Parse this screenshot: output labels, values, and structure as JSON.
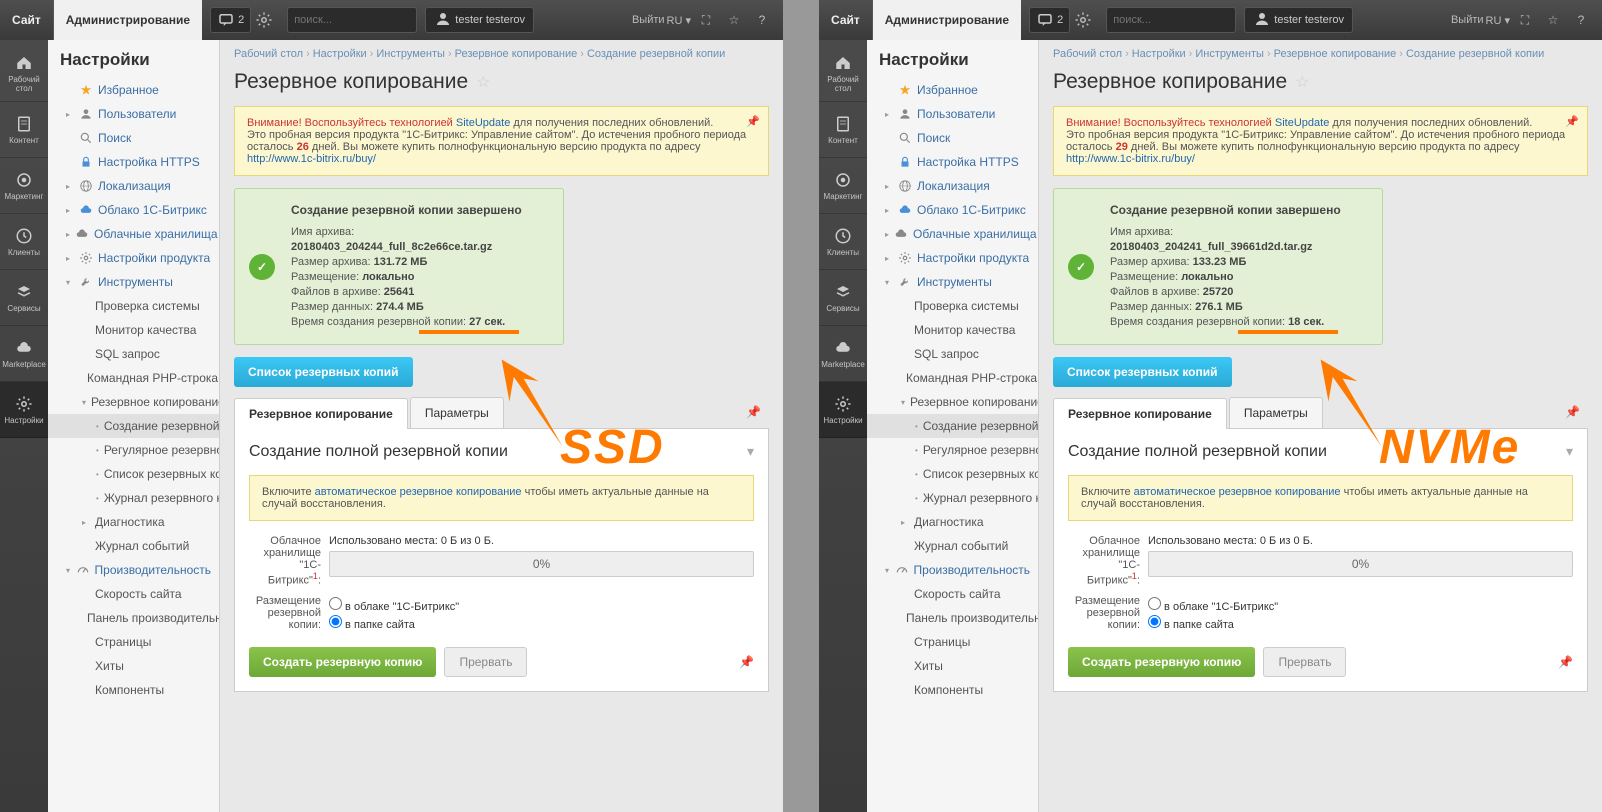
{
  "topbar": {
    "site": "Сайт",
    "admin": "Администрирование",
    "notif_count": "2",
    "search_placeholder": "поиск...",
    "user": "tester testerov",
    "logout": "Выйти",
    "lang": "RU"
  },
  "leftrail": [
    {
      "key": "desktop",
      "label": "Рабочий\nстол"
    },
    {
      "key": "content",
      "label": "Контент"
    },
    {
      "key": "marketing",
      "label": "Маркетинг"
    },
    {
      "key": "clients",
      "label": "Клиенты"
    },
    {
      "key": "services",
      "label": "Сервисы"
    },
    {
      "key": "marketplace",
      "label": "Marketplace"
    },
    {
      "key": "settings",
      "label": "Настройки"
    }
  ],
  "sidebar": {
    "title": "Настройки",
    "items": [
      {
        "label": "Избранное",
        "icon": "star",
        "color": "#f5a623"
      },
      {
        "label": "Пользователи",
        "icon": "user",
        "exp": true
      },
      {
        "label": "Поиск",
        "icon": "search"
      },
      {
        "label": "Настройка HTTPS",
        "icon": "lock",
        "color": "#4a90d9"
      },
      {
        "label": "Локализация",
        "icon": "globe",
        "exp": true
      },
      {
        "label": "Облако 1С-Битрикс",
        "icon": "cloud",
        "color": "#4a90d9",
        "exp": true
      },
      {
        "label": "Облачные хранилища",
        "icon": "cloud",
        "exp": true
      },
      {
        "label": "Настройки продукта",
        "icon": "gear",
        "exp": true
      },
      {
        "label": "Инструменты",
        "icon": "wrench",
        "open": true,
        "children": [
          {
            "label": "Проверка системы"
          },
          {
            "label": "Монитор качества"
          },
          {
            "label": "SQL запрос"
          },
          {
            "label": "Командная PHP-строка"
          },
          {
            "label": "Резервное копирование",
            "open": true,
            "children": [
              {
                "label": "Создание резервной ко",
                "active": true
              },
              {
                "label": "Регулярное резервное"
              },
              {
                "label": "Список резервных копи"
              },
              {
                "label": "Журнал резервного коп"
              }
            ]
          },
          {
            "label": "Диагностика",
            "exp": true
          },
          {
            "label": "Журнал событий"
          }
        ]
      },
      {
        "label": "Производительность",
        "icon": "speed",
        "open": true,
        "children": [
          {
            "label": "Скорость сайта"
          },
          {
            "label": "Панель производительнос"
          },
          {
            "label": "Страницы"
          },
          {
            "label": "Хиты"
          },
          {
            "label": "Компоненты"
          }
        ]
      }
    ]
  },
  "bc": [
    "Рабочий стол",
    "Настройки",
    "Инструменты",
    "Резервное копирование",
    "Создание резервной копии"
  ],
  "page_title": "Резервное копирование",
  "alert": {
    "warn": "Внимание! Воспользуйтесь технологией ",
    "link1": "SiteUpdate",
    "t1": " для получения последних обновлений.",
    "line2a": "Это пробная версия продукта \"1С-Битрикс: Управление сайтом\". До истечения пробного периода осталось ",
    "days_ssd": "26",
    "days_nvme": "29",
    "line2b": " дней. Вы можете купить полнофункциональную версию продукта по адресу ",
    "link2": "http://www.1c-bitrix.ru/buy/"
  },
  "success": {
    "title": "Создание резервной копии завершено",
    "labels": {
      "name": "Имя архива:",
      "size": "Размер архива:",
      "loc": "Размещение:",
      "files": "Файлов в архиве:",
      "dsize": "Размер данных:",
      "time": "Время создания резервной копии:"
    },
    "ssd": {
      "name": "20180403_204244_full_8c2e66ce.tar.gz",
      "size": "131.72 МБ",
      "loc": "локально",
      "files": "25641",
      "dsize": "274.4 МБ",
      "time": "27 сек."
    },
    "nvme": {
      "name": "20180403_204241_full_39661d2d.tar.gz",
      "size": "133.23 МБ",
      "loc": "локально",
      "files": "25720",
      "dsize": "276.1 МБ",
      "time": "18 сек."
    }
  },
  "list_btn": "Список резервных копий",
  "tabs": {
    "t1": "Резервное копирование",
    "t2": "Параметры"
  },
  "card": {
    "title": "Создание полной резервной копии",
    "ybox": {
      "a": "Включите ",
      "link": "автоматическое резервное копирование",
      "b": " чтобы иметь актуальные данные на случай восстановления."
    },
    "cloud_label": "Облачное\nхранилище\n\"1С-\nБитрикс\"",
    "cloud_sup": "1",
    "used": "Использовано места: 0 Б из 0 Б.",
    "progress": "0%",
    "place_label": "Размещение\nрезервной\nкопии:",
    "opt1": "в облаке \"1С-Битрикс\"",
    "opt2": "в папке сайта",
    "create": "Создать резервную копию",
    "cancel": "Прервать"
  },
  "overlay": {
    "ssd": "SSD",
    "nvme": "NVMe"
  }
}
